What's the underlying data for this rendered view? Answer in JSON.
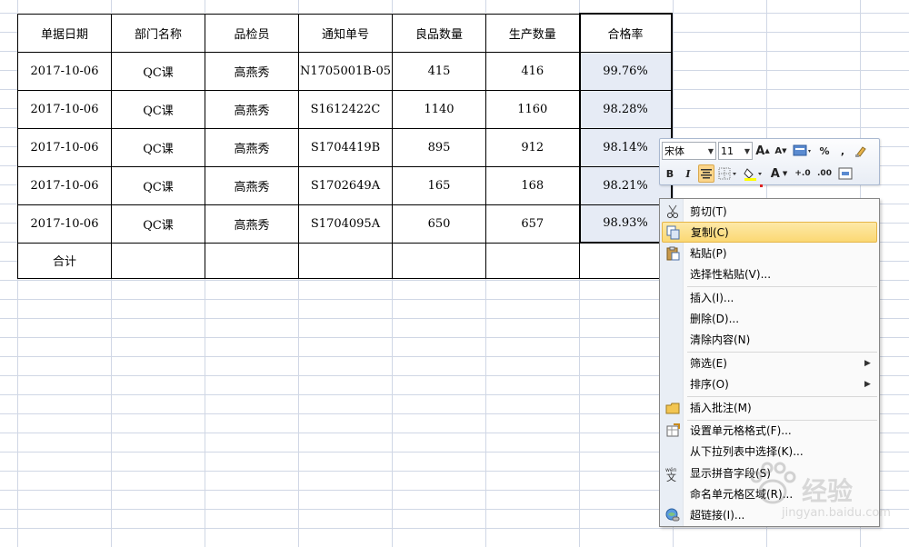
{
  "table": {
    "headers": [
      "单据日期",
      "部门名称",
      "品检员",
      "通知单号",
      "良品数量",
      "生产数量",
      "合格率"
    ],
    "rows": [
      [
        "2017-10-06",
        "QC课",
        "高燕秀",
        "N1705001B-05",
        "415",
        "416",
        "99.76%"
      ],
      [
        "2017-10-06",
        "QC课",
        "高燕秀",
        "S1612422C",
        "1140",
        "1160",
        "98.28%"
      ],
      [
        "2017-10-06",
        "QC课",
        "高燕秀",
        "S1704419B",
        "895",
        "912",
        "98.14%"
      ],
      [
        "2017-10-06",
        "QC课",
        "高燕秀",
        "S1702649A",
        "165",
        "168",
        "98.21%"
      ],
      [
        "2017-10-06",
        "QC课",
        "高燕秀",
        "S1704095A",
        "650",
        "657",
        "98.93%"
      ]
    ],
    "total_label": "合计"
  },
  "mini_toolbar": {
    "font_name": "宋体",
    "font_size": "11",
    "buttons_row1": [
      "A▲",
      "A▼",
      "merge-icon",
      "%",
      ",",
      "format-painter-icon"
    ],
    "buttons_row2": [
      "B",
      "I",
      "align-center-icon",
      "borders-icon",
      "fill-color-icon",
      "font-color-icon",
      "increase-decimal-icon",
      "decrease-decimal-icon",
      "merge-center-icon"
    ],
    "labels": {
      "bold": "B",
      "italic": "I",
      "grow": "A",
      "shrink": "A",
      "percent": "%",
      "comma": ",",
      "font_color": "A",
      "inc_decimal": "+.0​0",
      "dec_decimal": ".00"
    }
  },
  "context_menu": {
    "items": [
      {
        "label": "剪切(T)",
        "icon": "cut-icon"
      },
      {
        "label": "复制(C)",
        "icon": "copy-icon",
        "hover": true
      },
      {
        "label": "粘贴(P)",
        "icon": "paste-icon"
      },
      {
        "label": "选择性粘贴(V)...",
        "icon": ""
      },
      {
        "label": "插入(I)...",
        "icon": ""
      },
      {
        "label": "删除(D)...",
        "icon": ""
      },
      {
        "label": "清除内容(N)",
        "icon": ""
      },
      {
        "label": "筛选(E)",
        "icon": "",
        "submenu": true
      },
      {
        "label": "排序(O)",
        "icon": "",
        "submenu": true
      },
      {
        "label": "插入批注(M)",
        "icon": "insert-comment-icon"
      },
      {
        "label": "设置单元格格式(F)...",
        "icon": "format-cells-icon"
      },
      {
        "label": "从下拉列表中选择(K)...",
        "icon": ""
      },
      {
        "label": "显示拼音字段(S)",
        "icon": "phonetic-icon"
      },
      {
        "label": "命名单元格区域(R)...",
        "icon": ""
      },
      {
        "label": "超链接(I)...",
        "icon": "hyperlink-icon"
      }
    ]
  },
  "watermark": {
    "text": "经验",
    "url": "jingyan.baidu.com"
  },
  "colors": {
    "gridline": "#d0d7e5",
    "rate_cell_bg": "#e6ebf5",
    "menu_hover": "#fbd873",
    "menu_gutter": "#e9eef5"
  }
}
